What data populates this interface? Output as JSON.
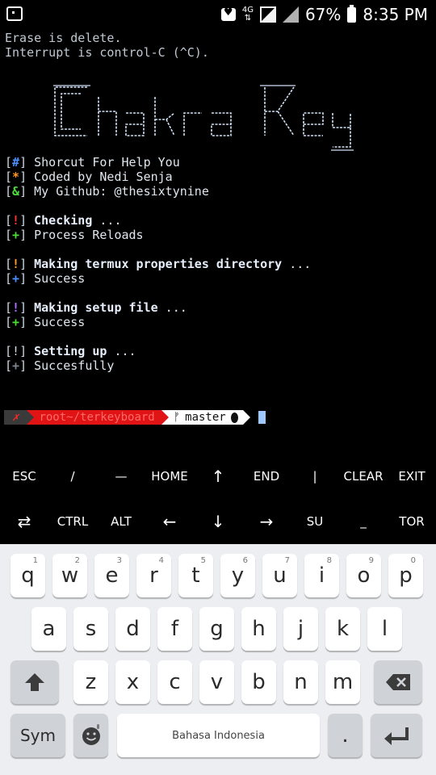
{
  "status_bar": {
    "network": "4G",
    "battery": "67%",
    "time": "8:35 PM"
  },
  "terminal": {
    "lines": {
      "erase": "Erase is delete.",
      "interrupt": "Interrupt is control-C (^C).",
      "help_bracket": "#",
      "help_text": "Shorcut For Help You",
      "coded_bracket": "*",
      "coded_text": "Coded by Nedi Senja",
      "github_bracket": "&",
      "github_text": "My Github: @thesixtynine",
      "checking_bracket": "!",
      "checking_text": "Checking",
      "checking_dots": " ...",
      "reloads_bracket": "+",
      "reloads_text": "Process Reloads",
      "making_dir_bracket": "!",
      "making_dir_text": "Making termux properties directory",
      "making_dir_dots": " ...",
      "success1_bracket": "+",
      "success1_text": "Success",
      "making_setup_bracket": "!",
      "making_setup_text": "Making setup file",
      "making_setup_dots": " ...",
      "success2_bracket": "+",
      "success2_text": "Success",
      "setting_bracket": "!",
      "setting_text": "Setting up",
      "setting_dots": " ...",
      "success3_bracket": "+",
      "success3_text": "Succesfully"
    },
    "banner_text": "Chakra Key",
    "prompt": {
      "status_mark": "✗",
      "path": "root~/terkeyboard",
      "branch_symbol": "ᚠ",
      "branch": "master"
    }
  },
  "extra_keys": {
    "row1": [
      "ESC",
      "/",
      "—",
      "HOME",
      "↑",
      "END",
      "|",
      "CLEAR",
      "EXIT"
    ],
    "row2": [
      "⇄",
      "CTRL",
      "ALT",
      "←",
      "↓",
      "→",
      "SU",
      "_",
      "TOR"
    ]
  },
  "keyboard": {
    "row1": [
      {
        "key": "q",
        "hint": "1"
      },
      {
        "key": "w",
        "hint": "2"
      },
      {
        "key": "e",
        "hint": "3"
      },
      {
        "key": "r",
        "hint": "4"
      },
      {
        "key": "t",
        "hint": "5"
      },
      {
        "key": "y",
        "hint": "6"
      },
      {
        "key": "u",
        "hint": "7"
      },
      {
        "key": "i",
        "hint": "8"
      },
      {
        "key": "o",
        "hint": "9"
      },
      {
        "key": "p",
        "hint": "0"
      }
    ],
    "row2": [
      "a",
      "s",
      "d",
      "f",
      "g",
      "h",
      "j",
      "k",
      "l"
    ],
    "row3": [
      "z",
      "x",
      "c",
      "v",
      "b",
      "n",
      "m"
    ],
    "sym_label": "Sym",
    "space_label": "Bahasa Indonesia",
    "period_label": "."
  },
  "colors": {
    "background": "#000000",
    "prompt_red": "#e01414",
    "cursor": "#9ec8ff",
    "keyboard_bg": "#eceef1"
  }
}
